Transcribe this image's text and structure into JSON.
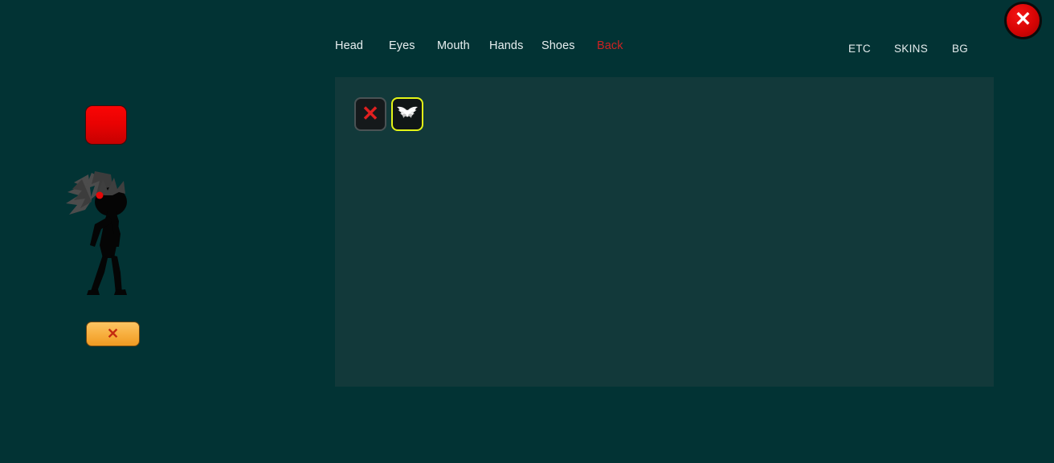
{
  "app": {
    "background_color": "#023334",
    "panel_color": "#12393a"
  },
  "nav": {
    "primary": [
      {
        "label": "Head",
        "active": false
      },
      {
        "label": "Eyes",
        "active": false
      },
      {
        "label": "Mouth",
        "active": false
      },
      {
        "label": "Hands",
        "active": false
      },
      {
        "label": "Shoes",
        "active": false
      },
      {
        "label": "Back",
        "active": true
      }
    ],
    "secondary": [
      {
        "label": "ETC"
      },
      {
        "label": "SKINS"
      },
      {
        "label": "BG"
      }
    ],
    "active_color": "#cd2222",
    "inactive_color": "#e8eff0"
  },
  "close_button": {
    "icon": "close-x-icon",
    "glyph": "✖",
    "color": "#d60404"
  },
  "panel": {
    "category": "Back",
    "slots": [
      {
        "name": "none-slot",
        "icon": "red-x-icon",
        "glyph": "✕",
        "selected": false
      },
      {
        "name": "wings-slot",
        "icon": "wings-icon",
        "glyph": "",
        "selected": true
      }
    ],
    "selection_color": "#e3f517"
  },
  "preview": {
    "color_button": {
      "name": "color-swatch-button",
      "color": "#e80202"
    },
    "character": {
      "name": "character-preview",
      "body_color": "#050505",
      "hair_color": "#4a4a4a",
      "eye_color": "#e50808"
    },
    "clear_button": {
      "name": "clear-button",
      "icon": "red-x-icon",
      "glyph": "✕",
      "color": "#f7ad3c"
    }
  }
}
